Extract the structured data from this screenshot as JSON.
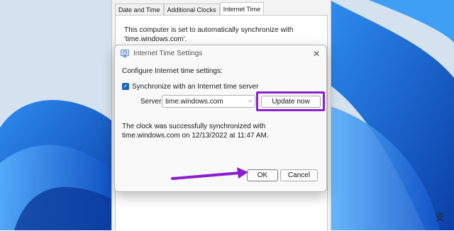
{
  "background_dialog": {
    "tabs": [
      {
        "label": "Date and Time"
      },
      {
        "label": "Additional Clocks"
      },
      {
        "label": "Internet Time"
      }
    ],
    "active_tab": "Internet Time",
    "description": "This computer is set to automatically synchronize with 'time.windows.com'."
  },
  "dialog": {
    "title": "Internet Time Settings",
    "configure_label": "Configure Internet time settings:",
    "sync_checkbox": {
      "label": "Synchronize with an Internet time server",
      "checked": true
    },
    "server_label": "Server:",
    "server_value": "time.windows.com",
    "update_button": "Update now",
    "status": "The clock was successfully synchronized with time.windows.com on 12/13/2022 at 11:47 AM.",
    "ok_button": "OK",
    "cancel_button": "Cancel"
  },
  "annotations": {
    "highlight_color": "#8a1fd0"
  },
  "icons": {
    "close": "close-icon",
    "dropdown": "chevron-down-icon",
    "checkbox": "checkmark-icon",
    "dialog": "clock-icon"
  },
  "corner_logo": "支"
}
